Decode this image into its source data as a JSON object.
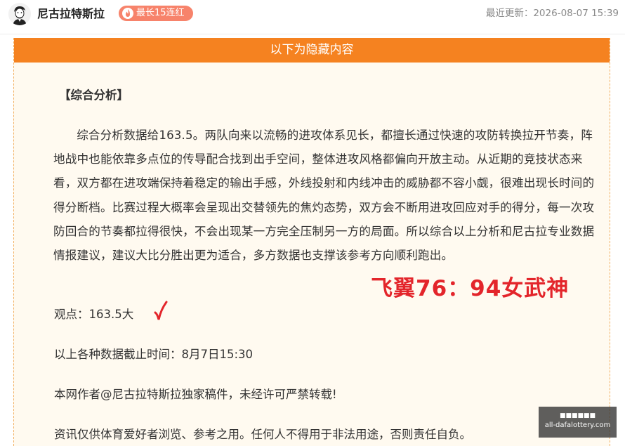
{
  "header": {
    "author_name": "尼古拉特斯拉",
    "streak_badge": "最长15连红",
    "last_updated": "最近更新：2026-08-07 15:39"
  },
  "card": {
    "banner_text": "以下为隐藏内容",
    "section_title": "【综合分析】",
    "analysis_text": "综合分析数据给163.5。两队向来以流畅的进攻体系见长，都擅长通过快速的攻防转换拉开节奏，阵地战中也能依靠多点位的传导配合找到出手空间，整体进攻风格都偏向开放主动。从近期的竞技状态来看，双方都在进攻端保持着稳定的输出手感，外线投射和内线冲击的威胁都不容小觑，很难出现长时间的得分断档。比赛过程大概率会呈现出交替领先的焦灼态势，双方会不断用进攻回应对手的得分，每一次攻防回合的节奏都拉得很快，不会出现某一方完全压制另一方的局面。所以综合以上分析和尼古拉专业数据情报建议，建议大比分胜出更为适合，多方数据也支撑该参考方向顺利跑出。",
    "score_stamp": "飞翼76：94女武神",
    "viewpoint": "观点：163.5大",
    "data_cutoff": "以上各种数据截止时间：8月7日15:30",
    "copyright": "本网作者@尼古拉特斯拉独家稿件，未经许可严禁转载!",
    "disclaimer": "资讯仅供体育爱好者浏览、参考之用。任何人不得用于非法用途，否则责任自负。"
  },
  "watermark": {
    "line1": "■■■■■■",
    "line2": "all-dafalottery.com"
  },
  "colors": {
    "banner": "#f58220",
    "badge": "#f7836b",
    "stamp_red": "#e3252b",
    "card_bg": "#fffaf0"
  },
  "icons": [
    "avatar",
    "fire-icon",
    "checkmark-icon"
  ]
}
